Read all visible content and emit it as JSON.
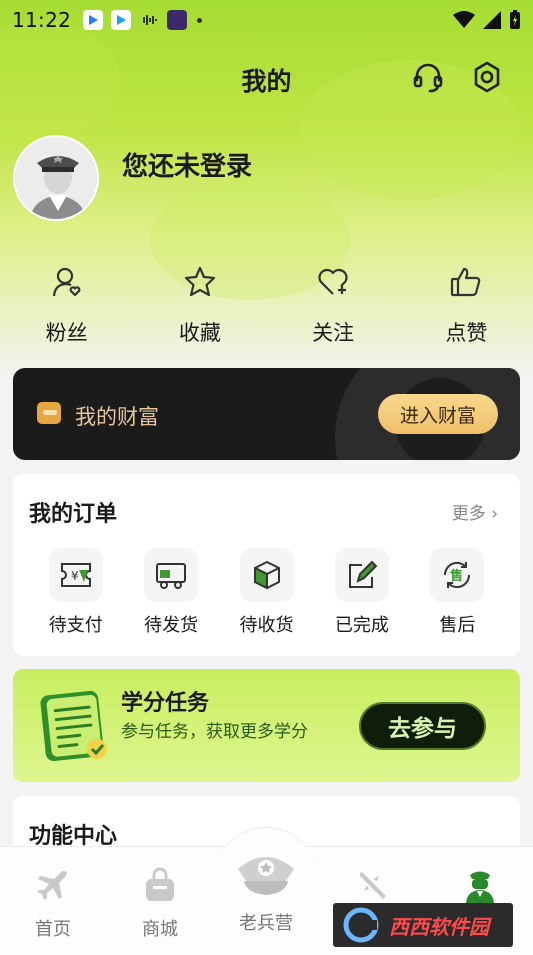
{
  "status_bar": {
    "time": "11:22"
  },
  "header": {
    "title": "我的",
    "support_icon": "headset-icon",
    "settings_icon": "gear-icon"
  },
  "profile": {
    "login_text": "您还未登录"
  },
  "stats": [
    {
      "label": "粉丝",
      "icon": "fans-icon"
    },
    {
      "label": "收藏",
      "icon": "star-icon"
    },
    {
      "label": "关注",
      "icon": "heart-plus-icon"
    },
    {
      "label": "点赞",
      "icon": "thumbs-up-icon"
    }
  ],
  "wealth": {
    "label": "我的财富",
    "button": "进入财富"
  },
  "orders": {
    "title": "我的订单",
    "more": "更多 ›",
    "items": [
      {
        "label": "待支付",
        "icon": "pending-payment-icon"
      },
      {
        "label": "待发货",
        "icon": "pending-shipment-icon"
      },
      {
        "label": "待收货",
        "icon": "pending-receipt-icon"
      },
      {
        "label": "已完成",
        "icon": "completed-icon"
      },
      {
        "label": "售后",
        "icon": "after-sales-icon"
      }
    ]
  },
  "task": {
    "title": "学分任务",
    "desc": "参与任务，获取更多学分",
    "button": "去参与"
  },
  "function_center": {
    "title": "功能中心"
  },
  "tabs": [
    {
      "label": "首页",
      "icon": "plane-icon"
    },
    {
      "label": "商城",
      "icon": "bag-icon"
    },
    {
      "label": "老兵营",
      "icon": "military-cap-icon"
    },
    {
      "label": "",
      "icon": "rocket-icon"
    },
    {
      "label": "",
      "icon": "soldier-icon"
    }
  ],
  "watermark": {
    "text": "西西软件园"
  },
  "colors": {
    "accent_green": "#a6dd32",
    "active_tab": "#2a8a2a",
    "wealth_bg": "#1b1b1b",
    "gold": "#efbf6a"
  }
}
